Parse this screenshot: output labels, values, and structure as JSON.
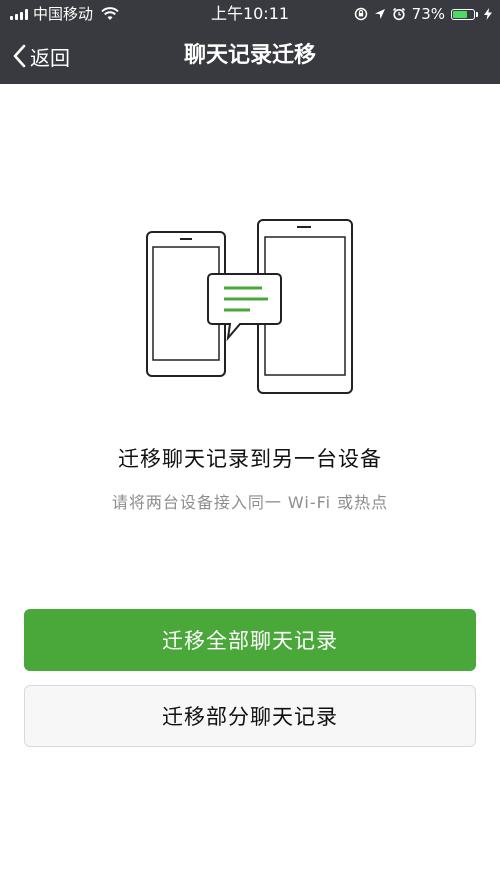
{
  "status_bar": {
    "carrier": "中国移动",
    "time": "上午10:11",
    "battery_percent_text": "73%",
    "battery_level": 0.73,
    "icons": [
      "signal-bars-icon",
      "wifi-icon",
      "orientation-lock-icon",
      "location-arrow-icon",
      "alarm-clock-icon",
      "battery-icon",
      "charging-bolt-icon"
    ],
    "battery_color": "#4cd964"
  },
  "navbar": {
    "back_label": "返回",
    "title": "聊天记录迁移",
    "background": "#393a3f"
  },
  "content": {
    "headline": "迁移聊天记录到另一台设备",
    "subline": "请将两台设备接入同一 Wi-Fi 或热点",
    "illustration_icon": "two-phones-chat-transfer-icon",
    "accent_color": "#4aa83a"
  },
  "actions": {
    "migrate_all_label": "迁移全部聊天记录",
    "migrate_partial_label": "迁移部分聊天记录"
  }
}
